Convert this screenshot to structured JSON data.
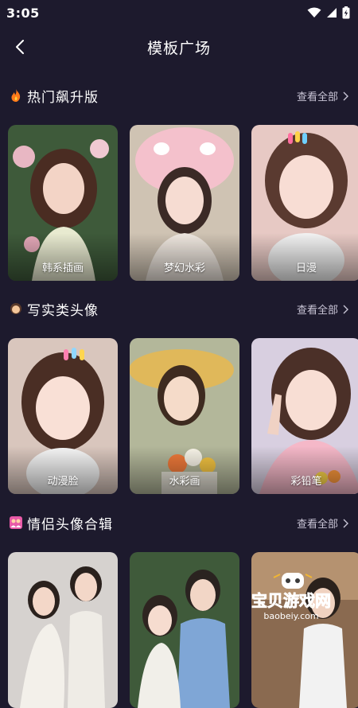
{
  "status": {
    "time": "3:05"
  },
  "nav": {
    "title": "模板广场"
  },
  "sections": [
    {
      "title": "热门飙升版",
      "see_all": "查看全部",
      "icon": "fire-icon",
      "cards": [
        {
          "label": "韩系插画"
        },
        {
          "label": "梦幻水彩"
        },
        {
          "label": "日漫"
        }
      ]
    },
    {
      "title": "写实类头像",
      "see_all": "查看全部",
      "icon": "girl-face-icon",
      "cards": [
        {
          "label": "动漫脸"
        },
        {
          "label": "水彩画"
        },
        {
          "label": "彩铅笔"
        }
      ]
    },
    {
      "title": "情侣头像合辑",
      "see_all": "查看全部",
      "icon": "couple-icon",
      "cards": [
        {
          "label": ""
        },
        {
          "label": ""
        },
        {
          "label": ""
        }
      ]
    }
  ],
  "watermark": {
    "text": "宝贝游戏网",
    "url": "baobeiy.com"
  },
  "colors": {
    "background": "#1d1a2d",
    "accent": "#f2b632"
  }
}
